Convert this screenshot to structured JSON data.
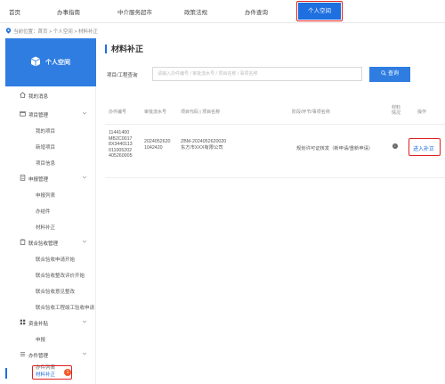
{
  "topnav": {
    "items": [
      "首页",
      "办事指南",
      "中介服务超市",
      "政策法规",
      "办件查询"
    ],
    "active": "个人空间"
  },
  "breadcrumb": "当前位置：首页 > 个人空间 > 材料补正",
  "sidebar": {
    "title": "个人空间",
    "groups": [
      {
        "label": "我的消息",
        "children": []
      },
      {
        "label": "项目管理",
        "children": [
          "我的项目",
          "新增项目",
          "项目信息"
        ]
      },
      {
        "label": "申报管理",
        "children": [
          "申报列表",
          "办结件",
          "材料补正"
        ]
      },
      {
        "label": "联合验收管理",
        "children": [
          "联合验收申请开始",
          "联合验收整改评价开始",
          "联合验收意见整改",
          "联合验收工程竣工验收申请"
        ]
      },
      {
        "label": "资金补贴",
        "children": [
          "申报"
        ]
      },
      {
        "label": "办件管理",
        "children": [
          "办件列表",
          "材料补正"
        ]
      }
    ],
    "badge": "1"
  },
  "main": {
    "title": "材料补正",
    "search_label": "项目/工程查询",
    "search_placeholder": "请输入办件编号 / 审批流水号 / 项目名称 / 事项名称",
    "search_button": "查询",
    "columns": [
      "办件编号",
      "审批流水号",
      "项目代码 | 项目名称",
      "阶段/环节/事项名称",
      "材料情况",
      "操作"
    ],
    "rows": [
      {
        "id_lines": [
          "11441400",
          "MB2C0017",
          "8X3440113",
          "011005202",
          "405260005"
        ],
        "flow_lines": [
          "2024052620",
          "1042420"
        ],
        "project_lines": [
          "ZBM-2024052620020",
          "东方市XXX有限公司"
        ],
        "stage": "规划许可证核发（新申请/重新申请）",
        "info_icon": "i",
        "action": "进入补正"
      }
    ]
  },
  "colors": {
    "accent": "#1e6fe0",
    "header_blue": "#2f7de1",
    "highlight": "#e02020",
    "badge": "#f05a28"
  }
}
